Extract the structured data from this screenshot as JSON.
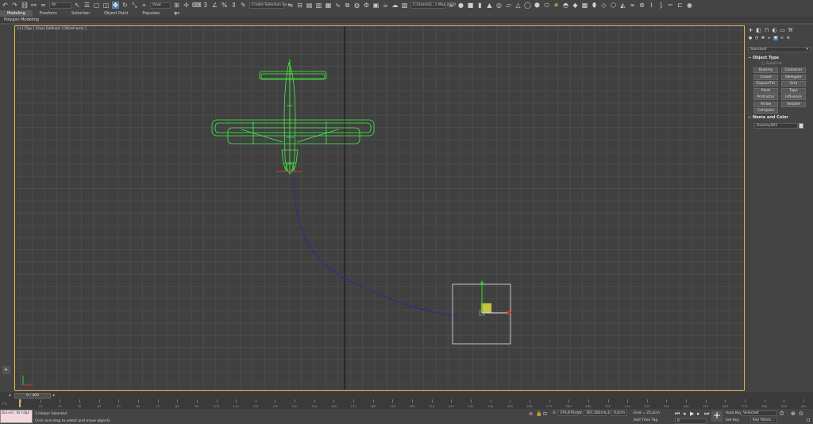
{
  "toolbar": {
    "selection_filter": "All",
    "ref_coord_system": "View",
    "selection_set": "Create Selection Se",
    "workspace": "C:\\Users\\G...s Max 2020",
    "snap_label": "3",
    "angle_snap_icon": "angle-snap-icon",
    "percent_snap_icon": "percent-snap-icon"
  },
  "ribbon": {
    "tabs": [
      "Modeling",
      "Freeform",
      "Selection",
      "Object Paint",
      "Populate"
    ],
    "active_tab": "Modeling",
    "subtitle": "Polygon Modeling"
  },
  "viewport": {
    "label": "[+] [Top ] [User Defined ] [Wireframe ]",
    "airplane_color": "#3ff23f",
    "path_color": "#2a2f86",
    "selection_box_color": "#e8e8e8"
  },
  "command_panel": {
    "category_dropdown": "Standard",
    "object_type_title": "Object Type",
    "autogrid_label": "AutoGrid",
    "object_buttons": [
      "Dummy",
      "Container",
      "Crowd",
      "Delegate",
      "ExposeTm",
      "Grid",
      "Point",
      "Tape",
      "Protractor",
      "Influence",
      "Arrow",
      "Volume",
      "Compass"
    ],
    "name_color_title": "Name and Color",
    "name_field": "Dummy001",
    "color": "#d9d9d9"
  },
  "timeline": {
    "slider_label": "0 / 400",
    "ruler_ticks": [
      "0",
      "10",
      "20",
      "30",
      "40",
      "50",
      "60",
      "70",
      "80",
      "90",
      "100",
      "110",
      "120",
      "130",
      "140",
      "150",
      "160",
      "170",
      "180",
      "190",
      "200",
      "210",
      "220",
      "230",
      "240",
      "250",
      "260",
      "270",
      "280",
      "290",
      "300",
      "310",
      "320",
      "330",
      "340",
      "350",
      "360",
      "370",
      "380",
      "390",
      "400"
    ],
    "current_frame": 0
  },
  "status": {
    "maxscript_label": "Quixel Bridge",
    "selection_message": "1 Helper Selected",
    "prompt_message": "Click and drag to select and move objects",
    "x_label": "X:",
    "x_value": "376,876cm",
    "y_label": "Y:",
    "y_value": "301,182cm",
    "z_label": "Z:",
    "z_value": "0,0cm",
    "grid_label": "Grid = 25,4cm",
    "add_time_tag": "Add Time Tag",
    "auto_key": "Auto Key",
    "auto_key_target": "Selected",
    "set_key": "Set Key",
    "key_filters": "Key Filters...",
    "frame_field": "0"
  }
}
